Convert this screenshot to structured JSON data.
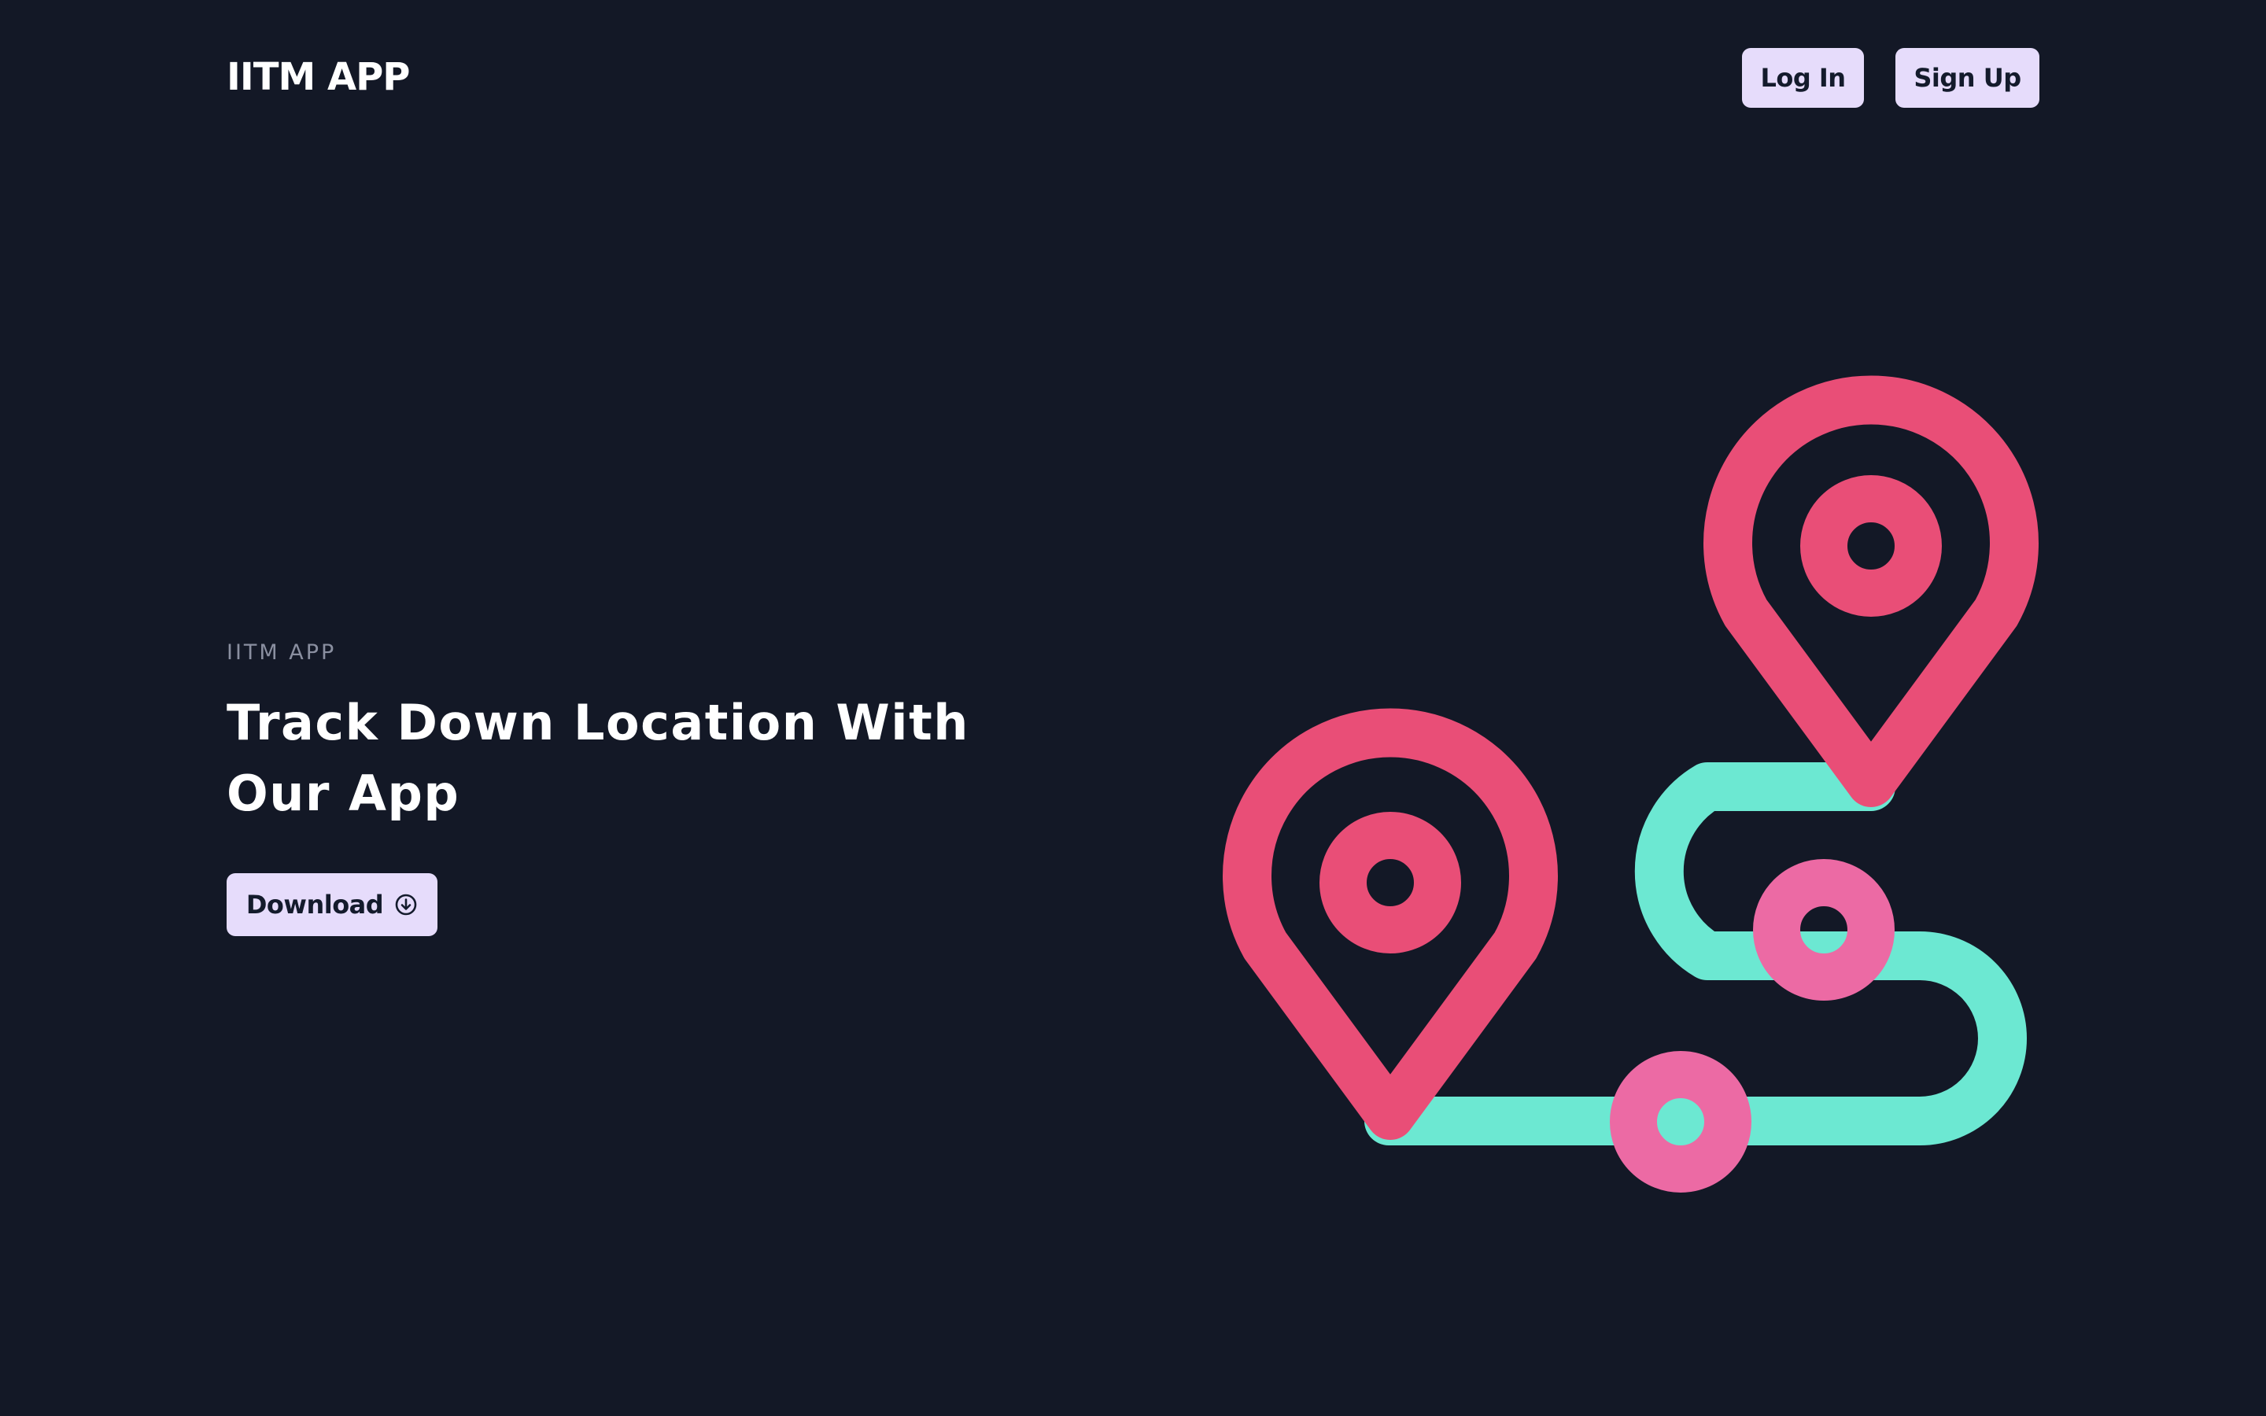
{
  "header": {
    "brand": "IITM APP",
    "login_label": "Log In",
    "signup_label": "Sign Up"
  },
  "hero": {
    "eyebrow": "IITM APP",
    "headline": "Track Down Location With Our App",
    "download_label": "Download",
    "download_icon": "arrow-circle-down-icon"
  },
  "illustration": {
    "icon": "route-map-pins-illustration",
    "colors": {
      "pin": "#e94e77",
      "waypoint": "#ec6aa4",
      "path": "#6ce8d2"
    }
  },
  "colors": {
    "background": "#131826",
    "button_bg": "#e6dcfb",
    "button_text": "#141b2c",
    "text_primary": "#ffffff",
    "text_muted": "#8a8fa0"
  }
}
